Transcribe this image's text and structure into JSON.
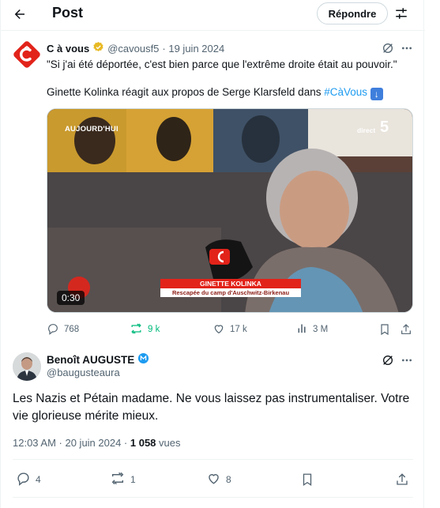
{
  "header": {
    "title": "Post",
    "reply_label": "Répondre"
  },
  "parent_tweet": {
    "name": "C à vous",
    "handle": "@cavousf5",
    "date": "· 19 juin 2024",
    "text_line1": "\"Si j'ai été déportée, c'est bien parce que l'extrême droite était au pouvoir.\"",
    "text_line2_prefix": "Ginette Kolinka réagit aux propos de Serge Klarsfeld dans",
    "hashtag": "#CàVous",
    "media": {
      "overlay_top_left": "AUJOURD'HUI",
      "channel_small": "direct",
      "channel_number": "5",
      "lower_third_name": "GINETTE KOLINKA",
      "lower_third_sub": "Rescapée du camp d'Auschwitz-Birkenau",
      "duration": "0:30"
    },
    "stats": {
      "replies": "768",
      "reposts": "9 k",
      "likes": "17 k",
      "views": "3 M"
    }
  },
  "main_tweet": {
    "name": "Benoît AUGUSTE",
    "handle": "@baugusteaura",
    "text": "Les Nazis et Pétain madame. Ne vous laissez pas instrumentaliser. Votre vie glorieuse mérite mieux.",
    "time": "12:03 AM · 20 juin 2024 · ",
    "views_count": "1 058",
    "views_label": " vues",
    "stats": {
      "replies": "4",
      "reposts": "1",
      "likes": "8"
    }
  },
  "colors": {
    "accent_blue": "#1d9bf0",
    "repost_green": "#00ba7c",
    "muted": "#536471",
    "cavous_red": "#e2231a",
    "verified_gold": "#e8b923"
  }
}
